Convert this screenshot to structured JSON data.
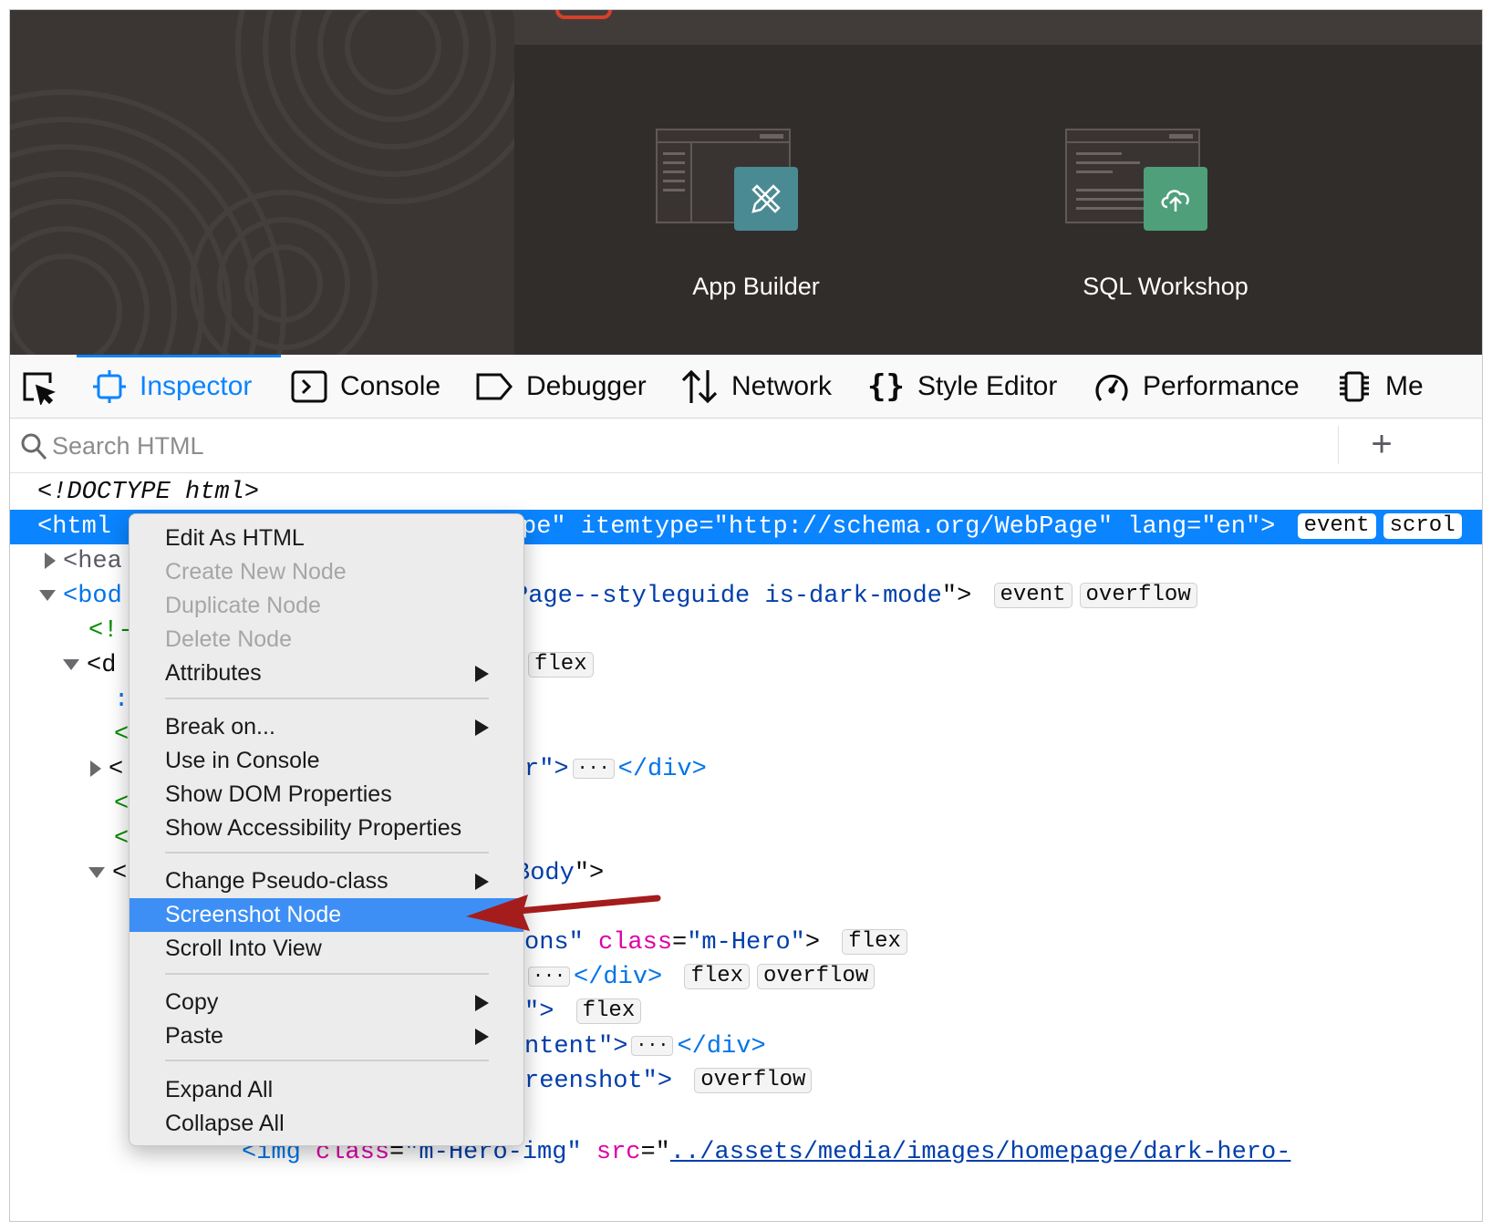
{
  "page": {
    "tiles": [
      {
        "label": "App Builder",
        "color": "#4a8a93",
        "icon": "pencil-ruler-icon"
      },
      {
        "label": "SQL Workshop",
        "color": "#4e9f7a",
        "icon": "cloud-upload-icon"
      }
    ]
  },
  "toolbar": {
    "tools": [
      {
        "label": "",
        "icon": "element-picker-icon"
      },
      {
        "label": "Inspector",
        "icon": "inspector-icon",
        "active": true
      },
      {
        "label": "Console",
        "icon": "console-icon"
      },
      {
        "label": "Debugger",
        "icon": "debugger-icon"
      },
      {
        "label": "Network",
        "icon": "network-icon"
      },
      {
        "label": "Style Editor",
        "icon": "style-editor-icon"
      },
      {
        "label": "Performance",
        "icon": "performance-icon"
      },
      {
        "label": "Me",
        "icon": "memory-icon"
      }
    ]
  },
  "search": {
    "placeholder": "Search HTML",
    "add_label": "+"
  },
  "tree": {
    "doctype": "<!DOCTYPE html>",
    "html_open": "<html",
    "html_rest": "pe\" itemtype=\"http://schema.org/WebPage\" lang=\"en\">",
    "html_badges": [
      "event",
      "scrol"
    ],
    "head": "<hea",
    "body": "<bod",
    "body_rest_a": "Page--styleguide is-dark-mode",
    "body_rest_b": "\">",
    "body_badges": [
      "event",
      "overflow"
    ],
    "comment": "<!-",
    "div1": "<d",
    "flex1": "flex",
    "colon": ":",
    "lt1": "<",
    "row_r": "r\">",
    "close_div": "</div>",
    "lt2": "<",
    "lt3": "<",
    "lt4": "<",
    "body_class_tail": "Body",
    "quote_gt": "\">",
    "ons": "ons\"",
    "class_attr": "class",
    "hero_val": "\"m-Hero\"",
    "gt": ">",
    "flex2": "flex",
    "close_div2": "</div>",
    "flex3": "flex",
    "overflow3": "overflow",
    "quote_gt2": "\">",
    "flex4": "flex",
    "ntent": "ntent\">",
    "close_div3": "</div>",
    "reenshot": "reenshot\">",
    "overflow5": "overflow",
    "img_tag": "<img",
    "img_class_attr": "class",
    "img_class_val": "\"m-Hero-img\"",
    "src_attr": "src",
    "src_val": "../assets/media/images/homepage/dark-hero-",
    "ellipsis": "···"
  },
  "menu": {
    "items": [
      {
        "label": "Edit As HTML",
        "disabled": false
      },
      {
        "label": "Create New Node",
        "disabled": true
      },
      {
        "label": "Duplicate Node",
        "disabled": true
      },
      {
        "label": "Delete Node",
        "disabled": true
      },
      {
        "label": "Attributes",
        "submenu": true
      },
      {
        "label": "Break on...",
        "submenu": true
      },
      {
        "label": "Use in Console"
      },
      {
        "label": "Show DOM Properties"
      },
      {
        "label": "Show Accessibility Properties"
      },
      {
        "label": "Change Pseudo-class",
        "submenu": true
      },
      {
        "label": "Screenshot Node",
        "highlighted": true
      },
      {
        "label": "Scroll Into View"
      },
      {
        "label": "Copy",
        "submenu": true
      },
      {
        "label": "Paste",
        "submenu": true
      },
      {
        "label": "Expand All"
      },
      {
        "label": "Collapse All"
      }
    ]
  },
  "annotation": {
    "arrow_color": "#a51c1c"
  }
}
